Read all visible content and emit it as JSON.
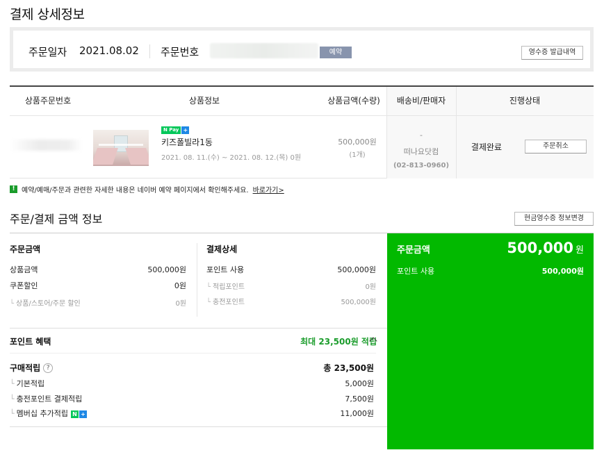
{
  "page_title": "결제 상세정보",
  "order": {
    "date_label": "주문일자",
    "date": "2021.08.02",
    "number_label": "주문번호",
    "tag": "예약",
    "receipt_button": "영수증 발급내역"
  },
  "table": {
    "headers": [
      "상품주문번호",
      "상품정보",
      "상품금액(수량)",
      "배송비/판매자",
      "진행상태"
    ],
    "row": {
      "npay_label": "Pay",
      "npay_plus": "+",
      "npay_n": "N",
      "name": "키즈폴빌라1동",
      "dates": "2021. 08. 11.(수) ~ 2021. 08. 12.(목) 0원",
      "price": "500,000원",
      "qty": "(1개)",
      "shipping": "-",
      "seller": "떠나요닷컴",
      "tel": "(02-813-0960)",
      "status": "결제완료",
      "cancel_button": "주문취소"
    }
  },
  "notice": {
    "icon": "!",
    "text": "예약/예매/주문과 관련한 자세한 내용은 네이버 예약 페이지에서 확인해주세요.",
    "link": "바로가기>"
  },
  "payment_section": {
    "title": "주문/결제 금액 정보",
    "cash_receipt_button": "현금영수증 정보변경",
    "order_amount": {
      "title": "주문금액",
      "product_label": "상품금액",
      "product_value": "500,000원",
      "coupon_label": "쿠폰할인",
      "coupon_value": "0원",
      "store_label": "상품/스토어/주문 할인",
      "store_value": "0원"
    },
    "payment_detail": {
      "title": "결제상세",
      "point_label": "포인트 사용",
      "point_value": "500,000원",
      "earned_label": "적립포인트",
      "earned_value": "0원",
      "charge_label": "충전포인트",
      "charge_value": "500,000원"
    },
    "benefit": {
      "title": "포인트 혜택",
      "max": "최대 23,500원 적립"
    },
    "purchase": {
      "title": "구매적립",
      "help": "?",
      "total": "총 23,500원",
      "items": [
        {
          "label": "기본적립",
          "value": "5,000원"
        },
        {
          "label": "충전포인트 결제적립",
          "value": "7,500원"
        },
        {
          "label": "멤버십 추가적립",
          "value": "11,000원"
        }
      ]
    },
    "summary": {
      "label": "주문금액",
      "total": "500,000",
      "won": "원",
      "point_label": "포인트 사용",
      "point_value": "500,000원"
    }
  },
  "colors": {
    "green": "#02b900",
    "tag": "#8894ad",
    "accent_green": "#1a9c2b"
  }
}
